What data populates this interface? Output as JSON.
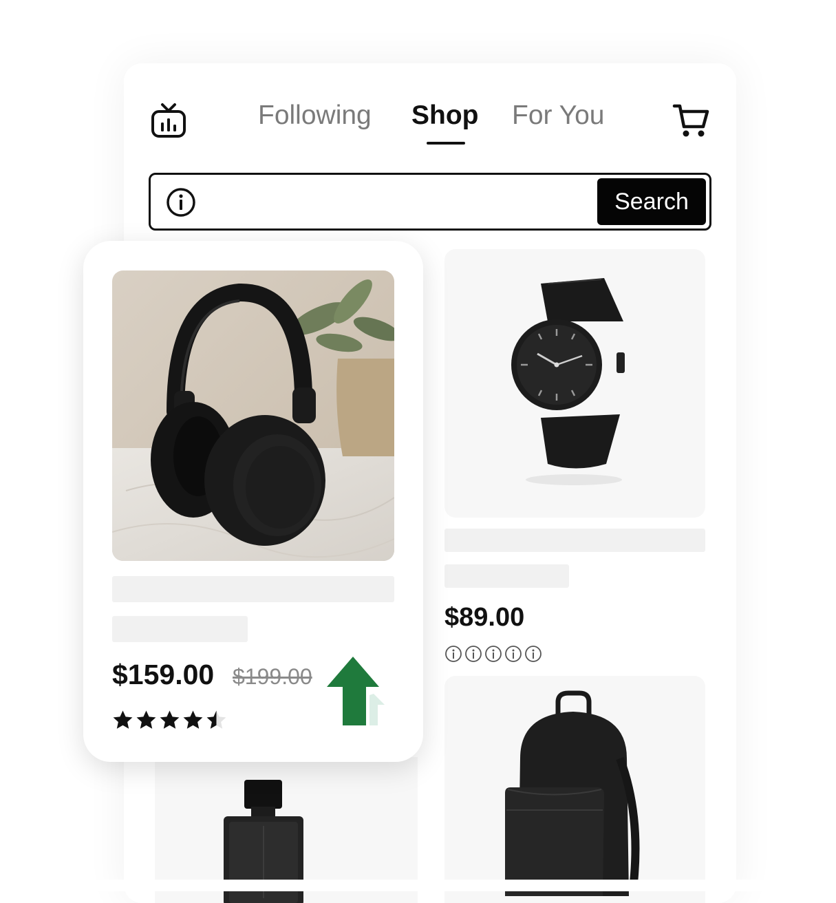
{
  "header": {
    "live_icon": "live-tv-icon",
    "tabs": [
      {
        "label": "Following",
        "active": false
      },
      {
        "label": "Shop",
        "active": true
      },
      {
        "label": "For You",
        "active": false
      }
    ],
    "cart_icon": "shopping-cart-icon"
  },
  "search": {
    "icon": "info-icon",
    "value": "",
    "button_label": "Search"
  },
  "products": {
    "featured": {
      "image": "headphones",
      "price": "$159.00",
      "original_price": "$199.00",
      "rating": 4.5,
      "trend_icon": "trending-up-arrow-icon",
      "trend_color": "#1f7a3c"
    },
    "watch": {
      "image": "watch",
      "price": "$89.00",
      "rating_icons": "info-icon"
    },
    "perfume": {
      "image": "perfume-bottle"
    },
    "backpack": {
      "image": "backpack"
    }
  },
  "colors": {
    "accent": "#111111",
    "muted_text": "#7a7a7a",
    "skeleton": "#f1f1f1",
    "trend_green": "#1f7a3c",
    "trend_light": "#dceee6"
  }
}
